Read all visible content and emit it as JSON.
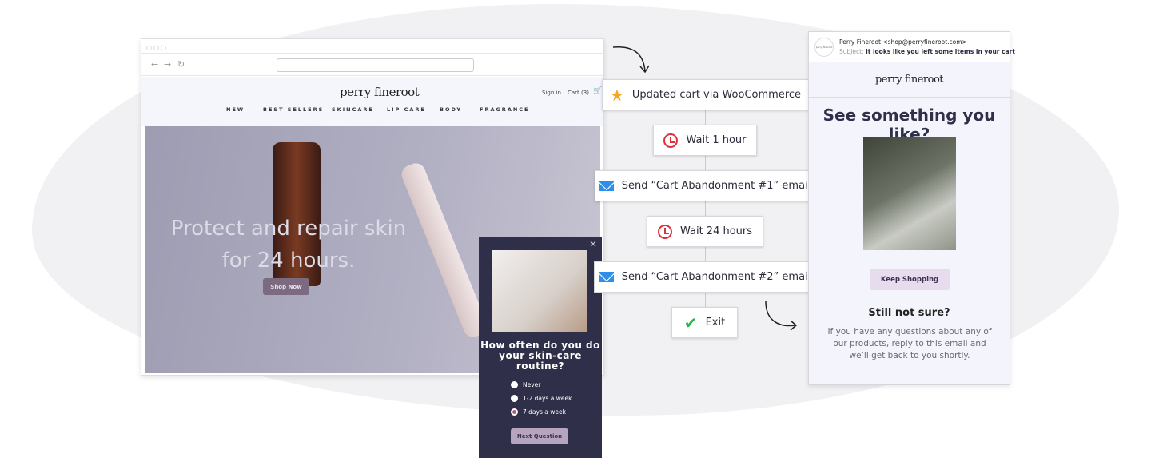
{
  "browser": {
    "nav": {
      "back": "←",
      "forward": "→",
      "reload": "↻"
    },
    "url": ""
  },
  "shop": {
    "logo": "perry fineroot",
    "sign_in": "Sign in",
    "cart": "Cart (3)",
    "menu": [
      "NEW",
      "BEST SELLERS",
      "SKINCARE",
      "LIP CARE",
      "BODY",
      "FRAGRANCE"
    ],
    "hero_title": "Protect and repair skin for 24 hours.",
    "hero_button": "Shop Now",
    "popup": {
      "question": "How often do you do your skin-care routine?",
      "options": [
        "Never",
        "1-2 days a week",
        "7 days a week"
      ],
      "selected": "7 days a week",
      "button": "Next Question",
      "close": "×"
    }
  },
  "workflow": {
    "steps": [
      {
        "icon": "star-icon",
        "label": "Updated cart via WooCommerce"
      },
      {
        "icon": "clock-icon",
        "label": "Wait 1 hour"
      },
      {
        "icon": "envelope-icon",
        "label": "Send “Cart Abandonment #1” email"
      },
      {
        "icon": "clock-icon",
        "label": "Wait 24 hours"
      },
      {
        "icon": "envelope-icon",
        "label": "Send “Cart Abandonment #2” email"
      },
      {
        "icon": "check-icon",
        "label": "Exit"
      }
    ],
    "colors": {
      "clock": "#e2303a",
      "envelope": "#2f8fe8",
      "star": "#f5a623",
      "check": "#2cb34a"
    }
  },
  "email": {
    "avatar": "perry fineroot",
    "from": "Perry Fineroot <shop@perryfineroot.com>",
    "subject_label": "Subject:",
    "subject": "It looks like you left some items in your cart",
    "logo": "perry fineroot",
    "headline": "See something you like?",
    "button": "Keep Shopping",
    "subheading": "Still not sure?",
    "body": "If you have any questions about any of our products, reply to this email and we’ll get back to you shortly."
  }
}
